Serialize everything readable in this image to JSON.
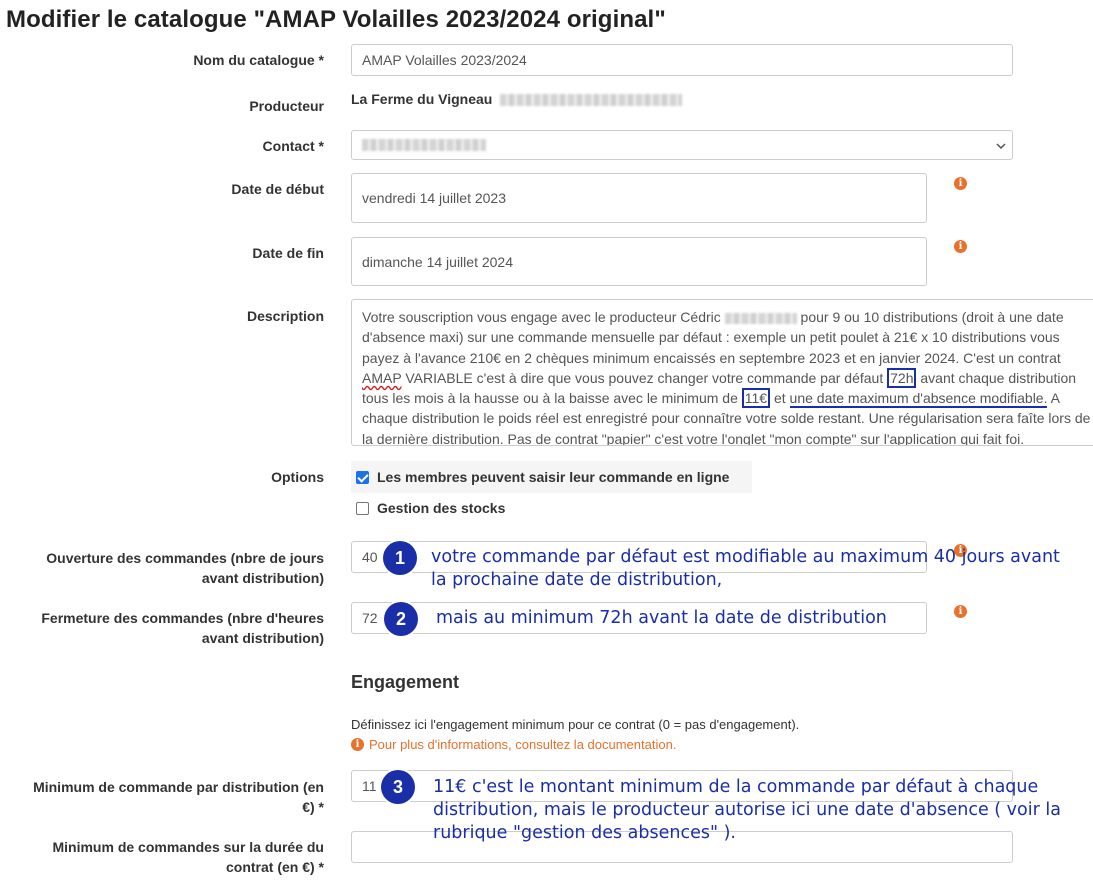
{
  "page": {
    "title": "Modifier le catalogue \"AMAP Volailles 2023/2024 original\""
  },
  "form": {
    "catalog_name": {
      "label": "Nom du catalogue *",
      "value": "AMAP Volailles 2023/2024"
    },
    "producer": {
      "label": "Producteur",
      "value": "La Ferme du Vigneau"
    },
    "contact": {
      "label": "Contact *"
    },
    "start_date": {
      "label": "Date de début",
      "value": "vendredi 14 juillet 2023"
    },
    "end_date": {
      "label": "Date de fin",
      "value": "dimanche 14 juillet 2024"
    },
    "description": {
      "label": "Description",
      "part1": "Votre souscription vous engage avec le producteur Cédric",
      "part2": " pour 9 ou 10 distributions (droit à une date d'absence maxi) sur une commande mensuelle par défaut : exemple un petit poulet à 21€ x 10 distributions vous payez à l'avance 210€ en 2 chèques minimum encaissés en septembre 2023 et en janvier 2024.  C'est un contrat ",
      "amap": "AMAP",
      "part3": " VARIABLE c'est à dire que vous pouvez changer votre commande par défaut ",
      "hl_72h": "72h",
      "part4": " avant chaque distribution tous les mois à la hausse ou à la baisse avec le minimum de ",
      "hl_11": "11€",
      "part5": " et ",
      "hl_absence": "une date maximum d'absence modifiable.",
      "part6": " A chaque distribution le poids réel est enregistré pour connaître votre solde restant. Une régularisation sera faîte lors de la dernière distribution. Pas de contrat \"papier\" c'est votre l'onglet \"mon compte\" sur l'application qui fait foi."
    },
    "options": {
      "label": "Options",
      "online_orders": {
        "label": "Les membres peuvent saisir leur commande en ligne",
        "checked": true
      },
      "stock_management": {
        "label": "Gestion des stocks",
        "checked": false
      }
    },
    "orders_open": {
      "label_line1": "Ouverture des commandes (nbre de jours",
      "label_line2": "avant distribution)",
      "value": "40"
    },
    "orders_close": {
      "label_line1": "Fermeture des commandes (nbre d'heures",
      "label_line2": "avant distribution)",
      "value": "72"
    },
    "engagement": {
      "title": "Engagement",
      "help": "Définissez ici l'engagement minimum pour ce contrat (0 = pas d'engagement).",
      "doc_link": "Pour plus d'informations, consultez la documentation."
    },
    "min_per_distribution": {
      "label_line1": "Minimum de commande par distribution (en",
      "label_line2": "€) *",
      "value": "11"
    },
    "min_total": {
      "label_line1": "Minimum de commandes sur la durée du",
      "label_line2": "contrat (en €) *",
      "value": ""
    }
  },
  "annotations": {
    "n1": {
      "number": "1",
      "line1": "votre commande par défaut est modifiable au maximum 40 jours avant",
      "line2": "la prochaine date de distribution,"
    },
    "n2": {
      "number": "2",
      "line1": "mais au minimum 72h avant la date de distribution"
    },
    "n3": {
      "number": "3",
      "line1": "11€ c'est le montant minimum de la commande par défaut à chaque",
      "line2": "distribution, mais le producteur autorise ici une date d'absence ( voir la",
      "line3": "rubrique \"gestion des absences\" )."
    }
  },
  "colors": {
    "info_orange": "#e8712b",
    "annotation_blue": "#1a2ea8",
    "checkbox_blue": "#1a73e8"
  },
  "icons": {
    "info": "info-icon",
    "select_arrow": "chevron-down-icon",
    "checkbox": "checkbox"
  }
}
